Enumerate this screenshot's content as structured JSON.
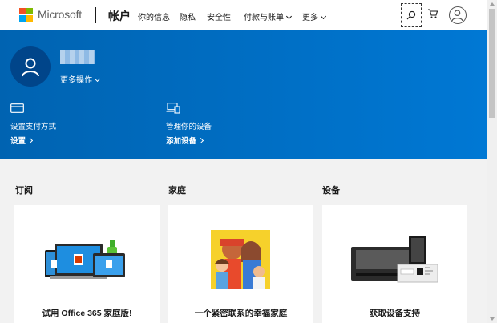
{
  "header": {
    "brand": "Microsoft",
    "account_title": "帐户",
    "nav": [
      {
        "label": "你的信息",
        "dropdown": false
      },
      {
        "label": "隐私",
        "dropdown": false
      },
      {
        "label": "安全性",
        "dropdown": false
      },
      {
        "label": "付款与账单",
        "dropdown": true
      },
      {
        "label": "更多",
        "dropdown": true
      }
    ],
    "icons": [
      "search-icon",
      "cart-icon",
      "account-avatar-icon"
    ]
  },
  "colors": {
    "logo": [
      "#f25022",
      "#7fba00",
      "#00a4ef",
      "#ffb900"
    ],
    "hero": "#0078d4",
    "hero_dark": "#00458a"
  },
  "hero": {
    "more_actions": "更多操作",
    "actions": [
      {
        "title": "设置支付方式",
        "link": "设置",
        "icon": "credit-card-icon"
      },
      {
        "title": "管理你的设备",
        "link": "添加设备",
        "icon": "devices-icon"
      }
    ]
  },
  "sections": [
    {
      "label": "订阅",
      "card_title": "试用 Office 365 家庭版!"
    },
    {
      "label": "家庭",
      "card_title": "一个紧密联系的幸福家庭"
    },
    {
      "label": "设备",
      "card_title": "获取设备支持"
    }
  ]
}
